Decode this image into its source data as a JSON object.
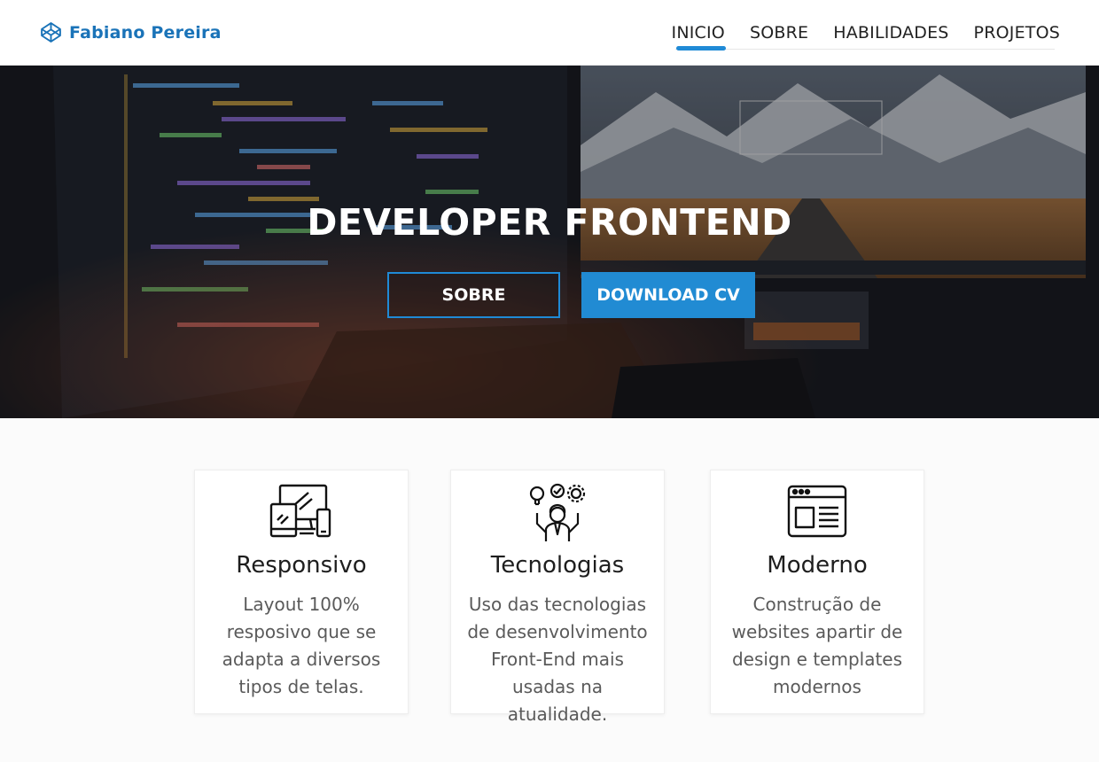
{
  "header": {
    "brand": "Fabiano Pereira",
    "brand_icon": "codepen-cube-icon",
    "nav": [
      "INICIO",
      "SOBRE",
      "HABILIDADES",
      "PROJETOS"
    ],
    "active_nav": "INICIO"
  },
  "hero": {
    "title": "DEVELOPER FRONTEND",
    "buttons": {
      "sobre": "SOBRE",
      "download": "DOWNLOAD CV"
    },
    "background": "desk-with-monitors-photo"
  },
  "features": [
    {
      "title": "Responsivo",
      "text": "Layout 100% resposivo que se adapta a diversos tipos de telas.",
      "icon": "responsive-devices-icon"
    },
    {
      "title": "Tecnologias",
      "text": "Uso das tecnologias de desenvolvimento Front-End  mais usadas na atualidade.",
      "icon": "person-ideas-gears-icon"
    },
    {
      "title": "Moderno",
      "text": "Construção de websites apartir de design e templates modernos",
      "icon": "browser-layout-icon"
    }
  ],
  "colors": {
    "accent": "#1f8ad6",
    "brand": "#1a73b8"
  }
}
